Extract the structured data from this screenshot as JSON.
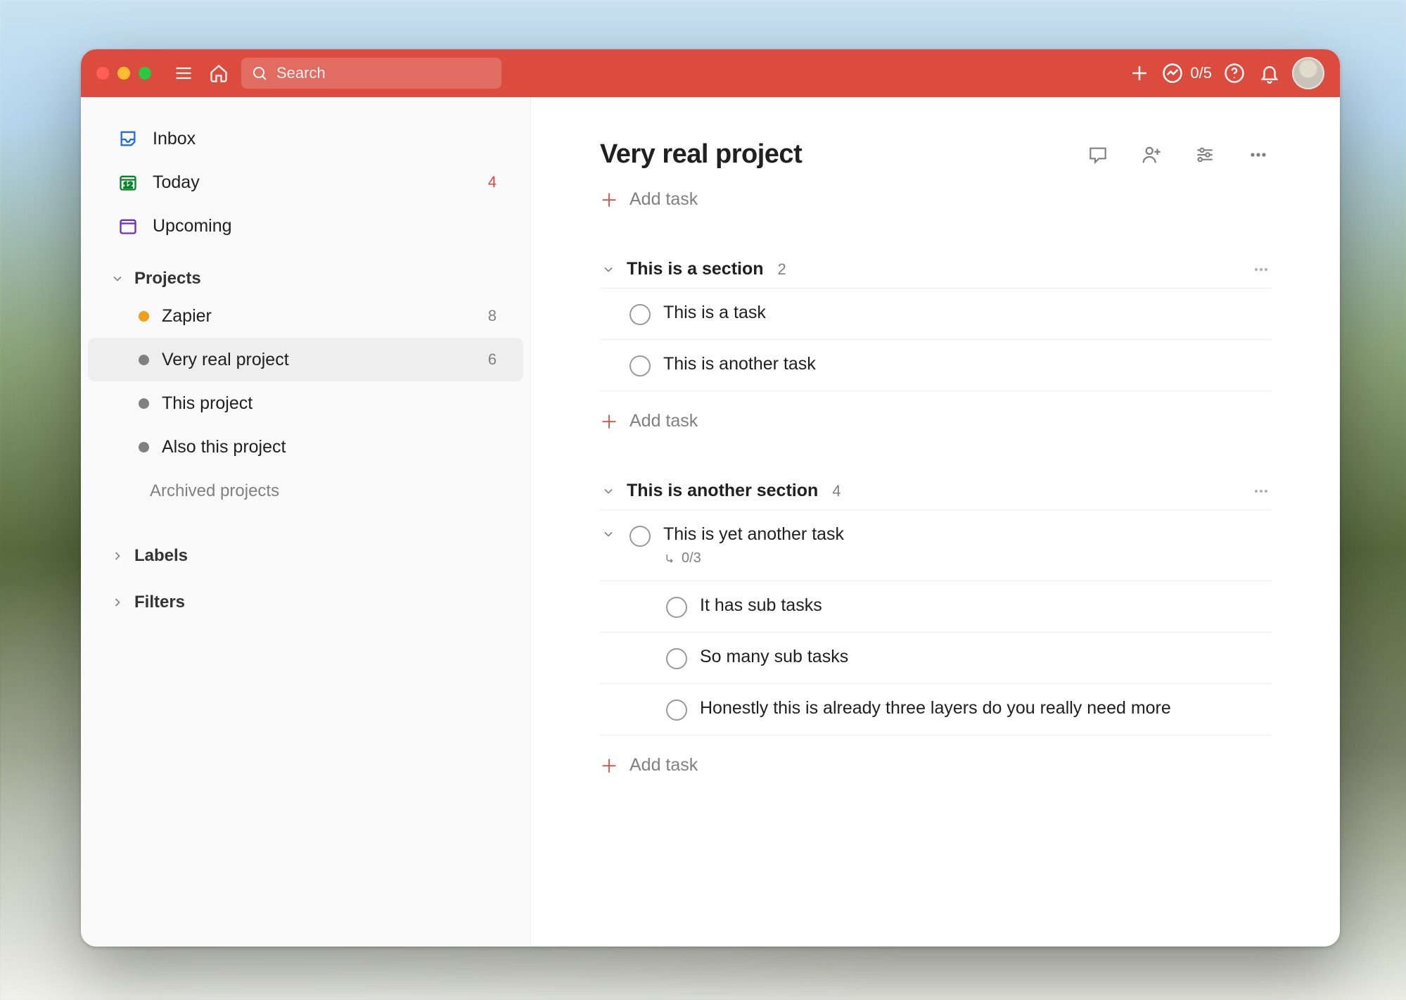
{
  "topbar": {
    "search_placeholder": "Search",
    "progress": "0/5"
  },
  "sidebar": {
    "nav": {
      "inbox": "Inbox",
      "today": "Today",
      "today_count": "4",
      "upcoming": "Upcoming"
    },
    "projects_header": "Projects",
    "projects": [
      {
        "name": "Zapier",
        "count": "8",
        "color": "orange"
      },
      {
        "name": "Very real project",
        "count": "6",
        "color": "grey",
        "active": true
      },
      {
        "name": "This project",
        "count": "",
        "color": "grey"
      },
      {
        "name": "Also this project",
        "count": "",
        "color": "grey"
      }
    ],
    "archived": "Archived projects",
    "labels": "Labels",
    "filters": "Filters"
  },
  "main": {
    "title": "Very real project",
    "add_task": "Add task",
    "sections": [
      {
        "title": "This is a section",
        "count": "2",
        "tasks": [
          {
            "title": "This is a task"
          },
          {
            "title": "This is another task"
          }
        ]
      },
      {
        "title": "This is another section",
        "count": "4",
        "tasks": [
          {
            "title": "This is yet another task",
            "subcount": "0/3",
            "expandable": true,
            "subtasks": [
              {
                "title": "It has sub tasks"
              },
              {
                "title": "So many sub tasks"
              },
              {
                "title": "Honestly this is already three layers do you really need more"
              }
            ]
          }
        ]
      }
    ]
  }
}
